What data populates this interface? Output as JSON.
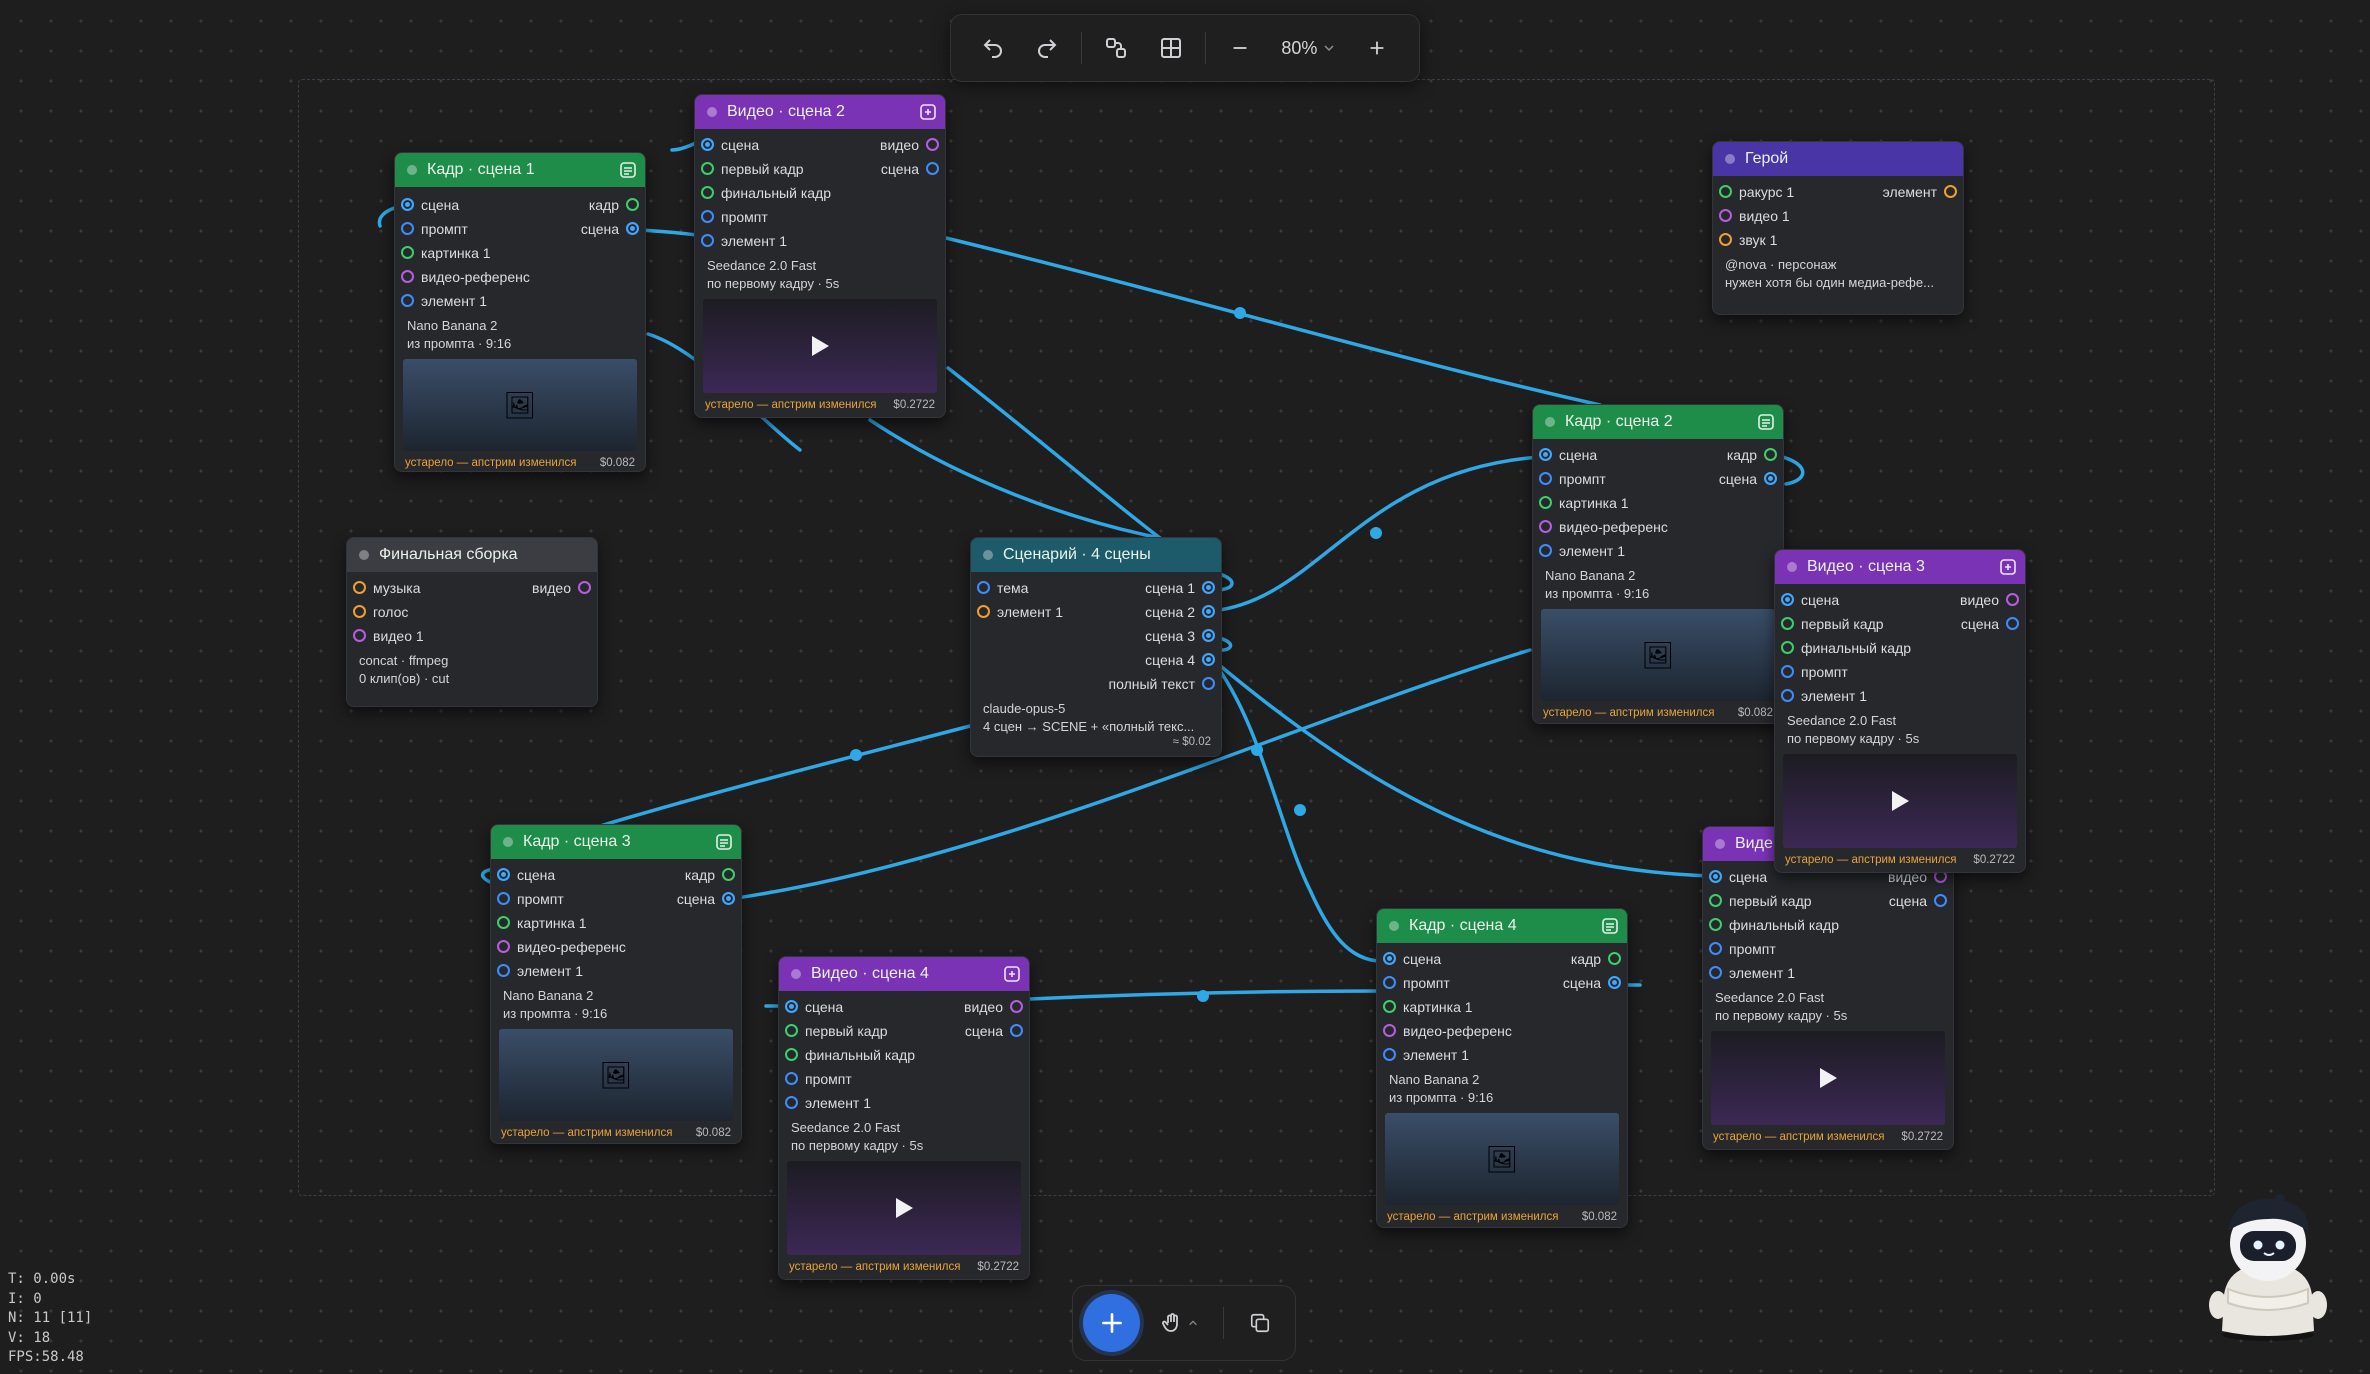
{
  "toolbar": {
    "zoom": "80%"
  },
  "stats": {
    "t": "T: 0.00s",
    "i": "I: 0",
    "n": "N: 11 [11]",
    "v": "V: 18",
    "fps": "FPS:58.48"
  },
  "common": {
    "stale_image": "устарело — апстрим изменился",
    "price_image": "$0.082",
    "price_video": "$0.2722"
  },
  "nodes": {
    "kadr1": {
      "title": "Кадр · сцена 1",
      "in": [
        "сцена",
        "промпт",
        "картинка 1",
        "видео-референс",
        "элемент 1"
      ],
      "out": [
        "кадр",
        "сцена"
      ],
      "info1": "Nano Banana 2",
      "info2": "из промпта · 9:16"
    },
    "video2": {
      "title": "Видео · сцена 2",
      "in": [
        "сцена",
        "первый кадр",
        "финальный кадр",
        "промпт",
        "элемент 1"
      ],
      "out": [
        "видео",
        "сцена"
      ],
      "info1": "Seedance 2.0 Fast",
      "info2": "по первому кадру · 5s"
    },
    "hero": {
      "title": "Герой",
      "in": [
        "ракурс 1",
        "видео 1",
        "звук 1"
      ],
      "out": [
        "элемент"
      ],
      "info1": "@nova · персонаж",
      "info2": "нужен хотя бы один медиа-рефе..."
    },
    "kadr2": {
      "title": "Кадр · сцена 2",
      "in": [
        "сцена",
        "промпт",
        "картинка 1",
        "видео-референс",
        "элемент 1"
      ],
      "out": [
        "кадр",
        "сцена"
      ],
      "info1": "Nano Banana 2",
      "info2": "из промпта · 9:16"
    },
    "final": {
      "title": "Финальная сборка",
      "in": [
        "музыка",
        "голос",
        "видео 1"
      ],
      "out": [
        "видео"
      ],
      "info1": "concat · ffmpeg",
      "info2": "0 клип(ов) · cut"
    },
    "scenario": {
      "title": "Сценарий · 4 сцены",
      "in": [
        "тема",
        "элемент 1"
      ],
      "out": [
        "сцена 1",
        "сцена 2",
        "сцена 3",
        "сцена 4",
        "полный текст"
      ],
      "info1": "claude-opus-5",
      "info2": "4 сцен → SCENE + «полный текс...",
      "price": "≈ $0.02"
    },
    "video3": {
      "title": "Видео · сцена 3",
      "in": [
        "сцена",
        "первый кадр",
        "финальный кадр",
        "промпт",
        "элемент 1"
      ],
      "out": [
        "видео",
        "сцена"
      ],
      "info1": "Seedance 2.0 Fast",
      "info2": "по первому кадру · 5s"
    },
    "kadr3": {
      "title": "Кадр · сцена 3",
      "in": [
        "сцена",
        "промпт",
        "картинка 1",
        "видео-референс",
        "элемент 1"
      ],
      "out": [
        "кадр",
        "сцена"
      ],
      "info1": "Nano Banana 2",
      "info2": "из промпта · 9:16"
    },
    "video4": {
      "title": "Видео · сцена 4",
      "in": [
        "сцена",
        "первый кадр",
        "финальный кадр",
        "промпт",
        "элемент 1"
      ],
      "out": [
        "видео",
        "сцена"
      ],
      "info1": "Seedance 2.0 Fast",
      "info2": "по первому кадру · 5s"
    },
    "kadr4": {
      "title": "Кадр · сцена 4",
      "in": [
        "сцена",
        "промпт",
        "картинка 1",
        "видео-референс",
        "элемент 1"
      ],
      "out": [
        "кадр",
        "сцена"
      ],
      "info1": "Nano Banana 2",
      "info2": "из промпта · 9:16"
    },
    "video1": {
      "title": "Виде",
      "in": [
        "сцена",
        "первый кадр",
        "финальный кадр",
        "промпт",
        "элемент 1"
      ],
      "out": [
        "видео",
        "сцена"
      ],
      "info1": "Seedance 2.0 Fast",
      "info2": "по первому кадру · 5s"
    }
  },
  "colors": {
    "edge": "#2fa8e6",
    "accent": "#2f6fe0"
  }
}
